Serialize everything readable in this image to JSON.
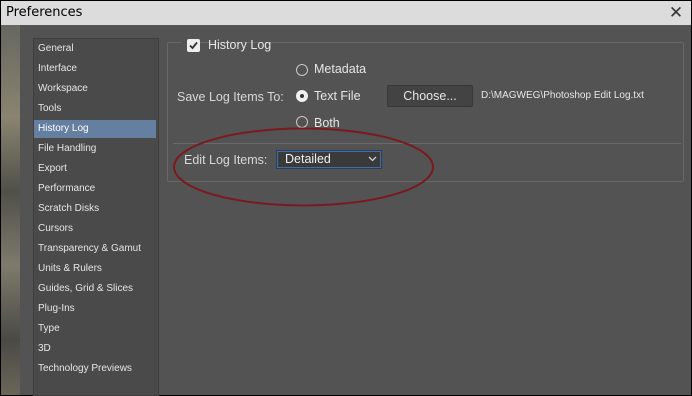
{
  "window": {
    "title": "Preferences",
    "close_symbol": "✕"
  },
  "sidebar": {
    "items": [
      {
        "label": "General",
        "selected": false
      },
      {
        "label": "Interface",
        "selected": false
      },
      {
        "label": "Workspace",
        "selected": false
      },
      {
        "label": "Tools",
        "selected": false
      },
      {
        "label": "History Log",
        "selected": true
      },
      {
        "label": "File Handling",
        "selected": false
      },
      {
        "label": "Export",
        "selected": false
      },
      {
        "label": "Performance",
        "selected": false
      },
      {
        "label": "Scratch Disks",
        "selected": false
      },
      {
        "label": "Cursors",
        "selected": false
      },
      {
        "label": "Transparency & Gamut",
        "selected": false
      },
      {
        "label": "Units & Rulers",
        "selected": false
      },
      {
        "label": "Guides, Grid & Slices",
        "selected": false
      },
      {
        "label": "Plug-Ins",
        "selected": false
      },
      {
        "label": "Type",
        "selected": false
      },
      {
        "label": "3D",
        "selected": false
      },
      {
        "label": "Technology Previews",
        "selected": false
      }
    ]
  },
  "history_log": {
    "enabled_label": "History Log",
    "enabled": true,
    "save_log_label": "Save Log Items To:",
    "options": [
      {
        "label": "Metadata",
        "checked": false
      },
      {
        "label": "Text File",
        "checked": true
      },
      {
        "label": "Both",
        "checked": false
      }
    ],
    "choose_button": "Choose...",
    "file_path": "D:\\MAGWEG\\Photoshop Edit Log.txt",
    "edit_log_label": "Edit Log Items:",
    "edit_log_value": "Detailed"
  },
  "colors": {
    "panel_bg": "#535353",
    "selected_item_bg": "#657fa0",
    "annotation_ellipse": "#7a1a1e"
  }
}
